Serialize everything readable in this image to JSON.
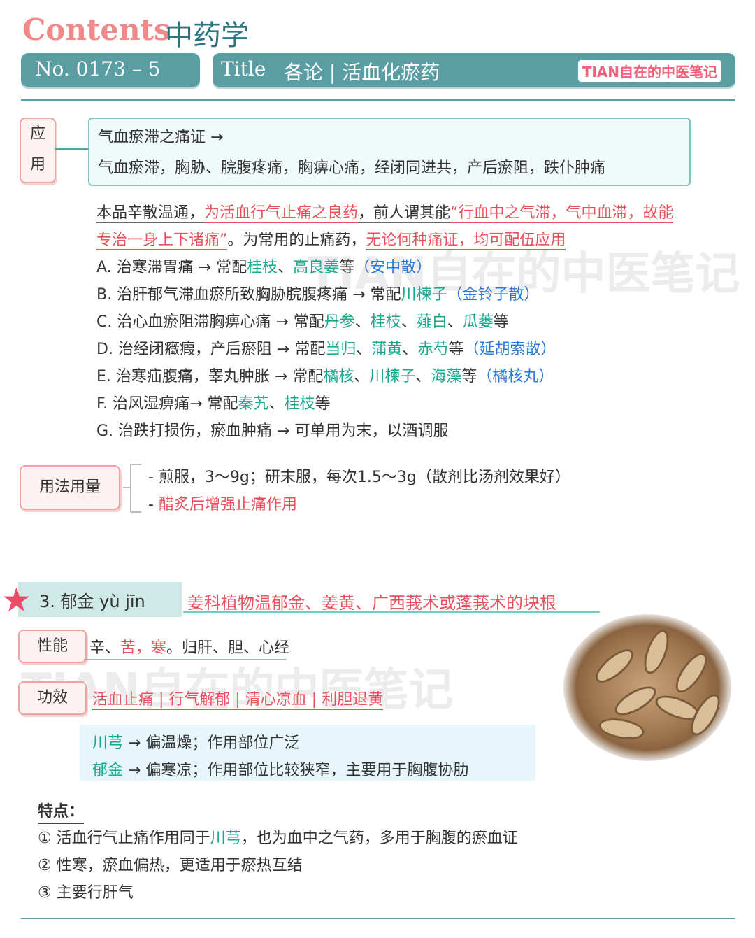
{
  "header": {
    "contents_label": "Contents",
    "subject": "中药学",
    "number": "No. 0173 – 5",
    "title_label": "Title",
    "title": "各论 | 活血化瘀药",
    "brand": "TIAN自在的中医笔记"
  },
  "application": {
    "tag_chars": [
      "应",
      "用"
    ],
    "box_line1": "气血瘀滞之痛证 →",
    "box_line2": "气血瘀滞，胸胁、脘腹疼痛，胸痹心痛，经闭同进共，产后瘀阻，跌仆肿痛",
    "summary": {
      "p1_plain": "本品辛散温通，",
      "p1_red": "为活血行气止痛之良药",
      "p1_plain2": "，前人谓其能",
      "p1_quote": "“行血中之气滞，气中血滞，故能",
      "p2_quote": "专治一身上下诸痛”",
      "p2_plain": "。为常用的止痛药，",
      "p2_red": "无论何种痛证，均可配伍应用"
    },
    "items": {
      "a": {
        "prefix": "A. 治寒滞胃痛 → 常配",
        "h1": "桂枝",
        "s1": "、",
        "h2": "高良姜",
        "mid": "等",
        "formula": "（安中散）"
      },
      "b": {
        "prefix": "B. 治肝郁气滞血瘀所致胸胁脘腹疼痛 → 常配",
        "h1": "川楝子",
        "formula": "（金铃子散）"
      },
      "c": {
        "prefix": "C. 治心血瘀阻滞胸痹心痛 → 常配",
        "h1": "丹参",
        "s1": "、",
        "h2": "桂枝",
        "s2": "、",
        "h3": "薤白",
        "s3": "、",
        "h4": "瓜蒌",
        "end": "等"
      },
      "d": {
        "prefix": "D. 治经闭癥瘕，产后瘀阻 → 常配",
        "h1": "当归",
        "s1": "、",
        "h2": "蒲黄",
        "s2": "、",
        "h3": "赤芍",
        "mid": "等",
        "formula": "（延胡索散）"
      },
      "e": {
        "prefix": "E. 治寒疝腹痛，睾丸肿胀 → 常配",
        "h1": "橘核",
        "s1": "、",
        "h2": "川楝子",
        "s2": "、",
        "h3": "海藻",
        "mid": "等",
        "formula": "（橘核丸）"
      },
      "f": {
        "prefix": "F. 治风湿痹痛→ 常配",
        "h1": "秦艽",
        "s1": "、",
        "h2": "桂枝",
        "end": "等"
      },
      "g": {
        "text": "G. 治跌打损伤，瘀血肿痛 → 可单用为末，以酒调服"
      }
    }
  },
  "usage": {
    "tag": "用法用量",
    "line1": "- 煎服，3～9g；研末服，每次1.5～3g（散剂比汤剂效果好）",
    "line2_dash": "- ",
    "line2_red": "醋炙后增强止痛作用"
  },
  "section3": {
    "title": "3.  郁金  yù jīn",
    "source": "姜科植物温郁金、姜黄、广西莪术或蓬莪术的块根",
    "xingneng_tag": "性能",
    "xingneng_a": "辛、",
    "xingneng_red": "苦，寒",
    "xingneng_b": "。归肝、胆、心经",
    "gongxiao_tag": "功效",
    "gongxiao": "活血止痛 | 行气解郁 | 清心凉血 | 利胆退黄",
    "compare": {
      "r1_herb": "川芎",
      "r1_text": " → 偏温燥；作用部位广泛",
      "r2_herb": "郁金",
      "r2_text": " → 偏寒凉；作用部位比较狭窄，主要用于胸腹协肋"
    },
    "features_title": "特点：",
    "f1_a": "① 活血行气止痛作用同于",
    "f1_herb": "川芎",
    "f1_b": "，也为血中之气药，多用于胸腹的瘀血证",
    "f2": "② 性寒，瘀血偏热，更适用于瘀热互结",
    "f3": "③ 主要行肝气"
  },
  "watermark": "TIAN自在的中医笔记",
  "colors": {
    "teal": "#5a9ea4",
    "pink": "#f08a8a",
    "red": "#e8505b",
    "green": "#18a88e",
    "blue": "#2b7bd6"
  }
}
